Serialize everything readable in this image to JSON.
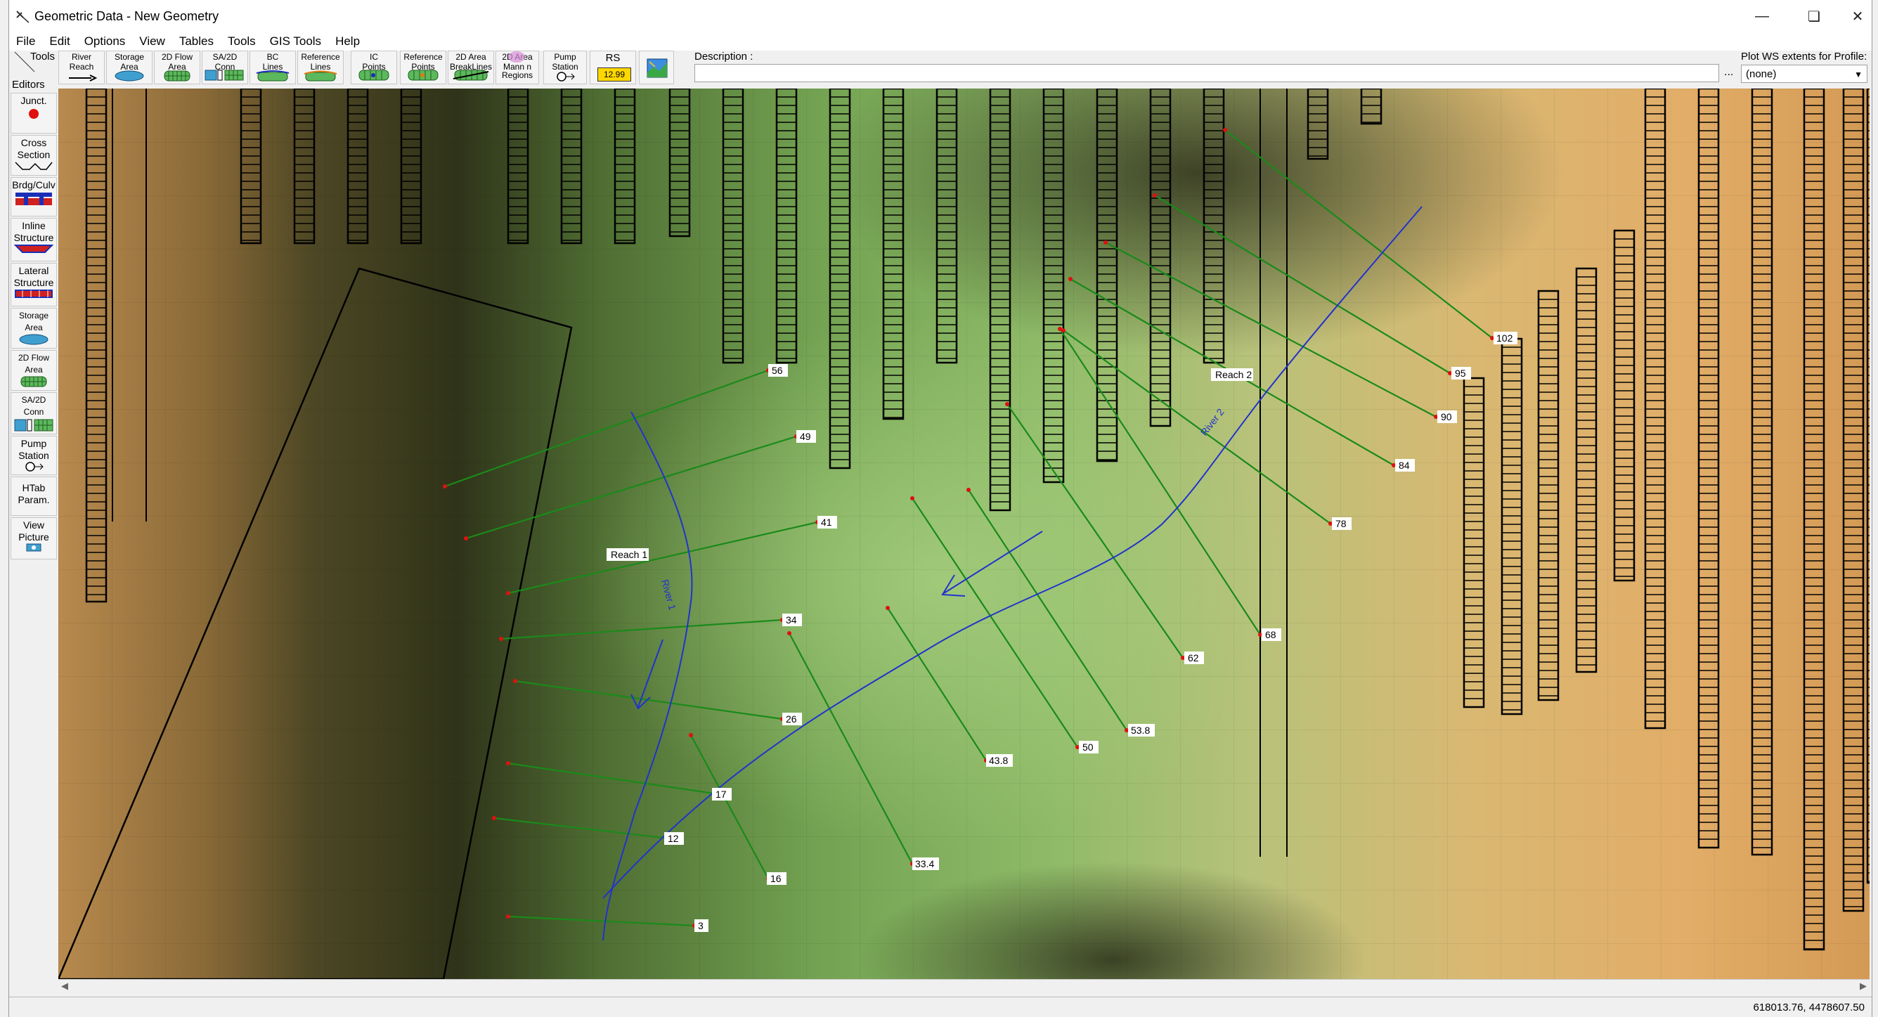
{
  "window": {
    "title": "Geometric Data - New Geometry"
  },
  "menu": [
    "File",
    "Edit",
    "Options",
    "View",
    "Tables",
    "Tools",
    "GIS Tools",
    "Help"
  ],
  "toolbar": {
    "tools_label": "Tools",
    "buttons": [
      {
        "id": "river-reach",
        "line1": "River",
        "line2": "Reach"
      },
      {
        "id": "storage-area",
        "line1": "Storage",
        "line2": "Area"
      },
      {
        "id": "2d-flow-area",
        "line1": "2D Flow",
        "line2": "Area"
      },
      {
        "id": "sa2d-conn",
        "line1": "SA/2D",
        "line2": "Conn"
      },
      {
        "id": "bc-lines",
        "line1": "BC",
        "line2": "Lines"
      },
      {
        "id": "reference-lines",
        "line1": "Reference",
        "line2": "Lines"
      },
      {
        "id": "ic-points",
        "line1": "IC",
        "line2": "Points"
      },
      {
        "id": "reference-points",
        "line1": "Reference",
        "line2": "Points"
      },
      {
        "id": "2d-area-breaklines",
        "line1": "2D Area",
        "line2": "BreakLines"
      },
      {
        "id": "2d-area-mannings",
        "line1": "2D Area",
        "line2": "Mann n Regions"
      },
      {
        "id": "pump-station",
        "line1": "Pump",
        "line2": "Station"
      },
      {
        "id": "rs",
        "line1": "RS",
        "line2": "12.99"
      }
    ],
    "description_label": "Description :",
    "description_value": "",
    "more_button": "...",
    "plot_ws_label": "Plot WS extents for Profile:",
    "plot_ws_value": "(none)"
  },
  "editors": {
    "label": "Editors",
    "buttons": [
      {
        "id": "junct",
        "line1": "Junct.",
        "line2": ""
      },
      {
        "id": "cross-section",
        "line1": "Cross",
        "line2": "Section"
      },
      {
        "id": "brdg-culv",
        "line1": "Brdg/Culv",
        "line2": ""
      },
      {
        "id": "inline-structure",
        "line1": "Inline",
        "line2": "Structure"
      },
      {
        "id": "lateral-structure",
        "line1": "Lateral",
        "line2": "Structure"
      },
      {
        "id": "storage-area",
        "line1": "Storage",
        "line2": "Area"
      },
      {
        "id": "2d-flow-area",
        "line1": "2D Flow",
        "line2": "Area"
      },
      {
        "id": "sa2d-conn",
        "line1": "SA/2D",
        "line2": "Conn"
      },
      {
        "id": "pump-station",
        "line1": "Pump",
        "line2": "Station"
      },
      {
        "id": "htab-param",
        "line1": "HTab",
        "line2": "Param."
      },
      {
        "id": "view-picture",
        "line1": "View",
        "line2": "Picture"
      }
    ]
  },
  "map": {
    "reaches": [
      {
        "label": "Reach 1",
        "river": "River 1"
      },
      {
        "label": "Reach 2",
        "river": "River 2"
      }
    ],
    "cross_sections": [
      {
        "label": "56"
      },
      {
        "label": "49"
      },
      {
        "label": "41"
      },
      {
        "label": "34"
      },
      {
        "label": "26"
      },
      {
        "label": "17"
      },
      {
        "label": "12"
      },
      {
        "label": "16"
      },
      {
        "label": "3"
      },
      {
        "label": "33.4"
      },
      {
        "label": "43.8"
      },
      {
        "label": "50"
      },
      {
        "label": "53.8"
      },
      {
        "label": "62"
      },
      {
        "label": "68"
      },
      {
        "label": "78"
      },
      {
        "label": "84"
      },
      {
        "label": "90"
      },
      {
        "label": "95"
      },
      {
        "label": "102"
      }
    ]
  },
  "status": {
    "coordinates": "618013.76, 4478607.50"
  },
  "colors": {
    "xs_line": "#1a8a1a",
    "river": "#2233cc",
    "xs_label_bg": "#ffffff",
    "terrain_dark": "#2e3018",
    "terrain_green": "#8fb86a",
    "terrain_tan": "#d8a060"
  }
}
